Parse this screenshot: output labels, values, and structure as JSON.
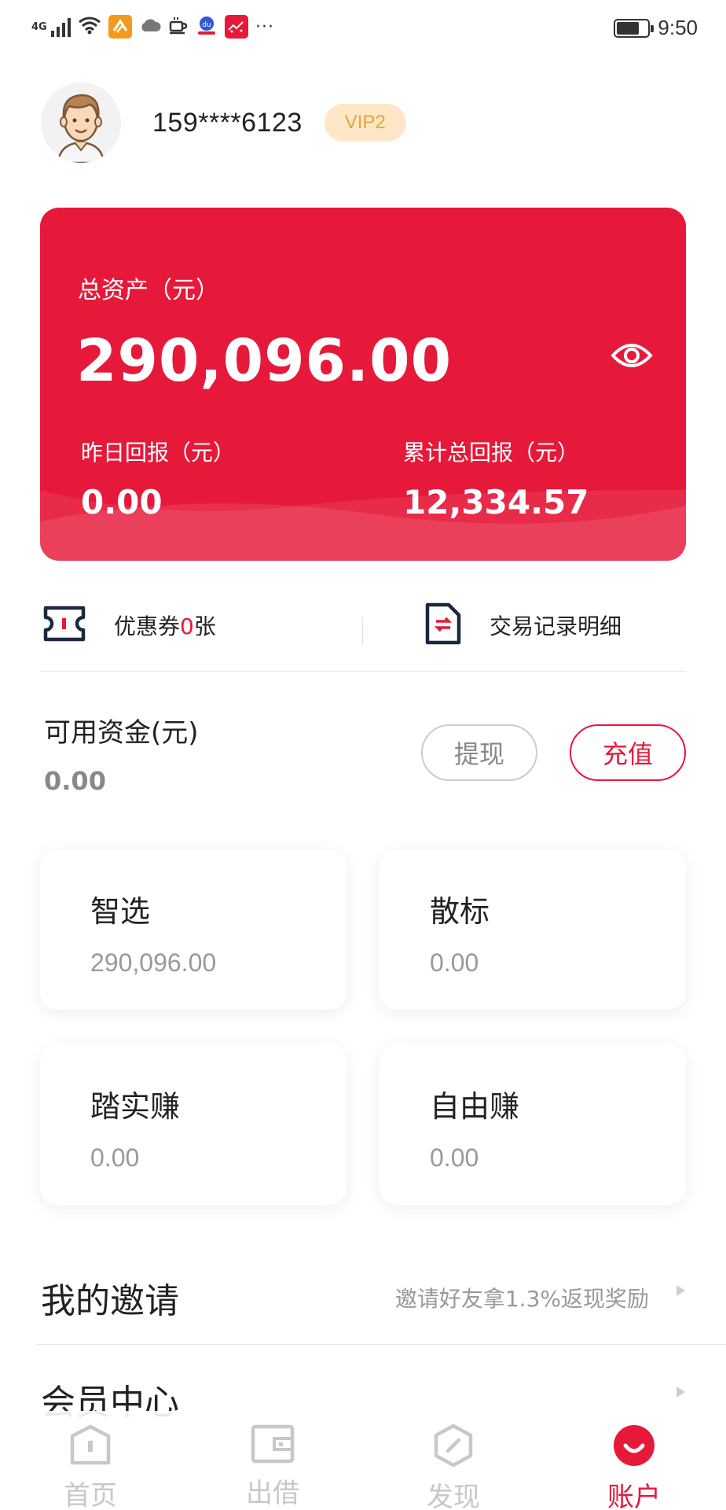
{
  "status_bar": {
    "network": "4G",
    "time": "9:50",
    "app_icons": [
      "app-orange-icon",
      "cloud-icon",
      "coffee-icon",
      "baidu-icon",
      "app-red-icon"
    ],
    "more": "···"
  },
  "user": {
    "phone": "159****6123",
    "vip_badge": "VIP2"
  },
  "asset_card": {
    "total_label": "总资产（元）",
    "total_value": "290,096.00",
    "yesterday_label": "昨日回报（元）",
    "yesterday_value": "0.00",
    "cumulative_label": "累计总回报（元）",
    "cumulative_value": "12,334.57"
  },
  "shortcuts": {
    "coupon_prefix": "优惠券",
    "coupon_count": "0",
    "coupon_suffix": "张",
    "trade_records": "交易记录明细"
  },
  "funds": {
    "label": "可用资金(元)",
    "value": "0.00",
    "withdraw_button": "提现",
    "recharge_button": "充值"
  },
  "products": [
    {
      "name": "智选",
      "value": "290,096.00"
    },
    {
      "name": "散标",
      "value": "0.00"
    },
    {
      "name": "踏实赚",
      "value": "0.00"
    },
    {
      "name": "自由赚",
      "value": "0.00"
    }
  ],
  "menu": {
    "invite_title": "我的邀请",
    "invite_hint": "邀请好友拿1.3%返现奖励",
    "member_title": "会员中心"
  },
  "tabs": [
    {
      "label": "首页",
      "icon": "home-icon",
      "active": false
    },
    {
      "label": "出借",
      "icon": "wallet-icon",
      "active": false
    },
    {
      "label": "发现",
      "icon": "compass-icon",
      "active": false
    },
    {
      "label": "账户",
      "icon": "account-icon",
      "active": true
    }
  ],
  "colors": {
    "brand_red": "#e6193a",
    "vip_bg": "#fde7c6",
    "vip_text": "#e8a33b"
  }
}
